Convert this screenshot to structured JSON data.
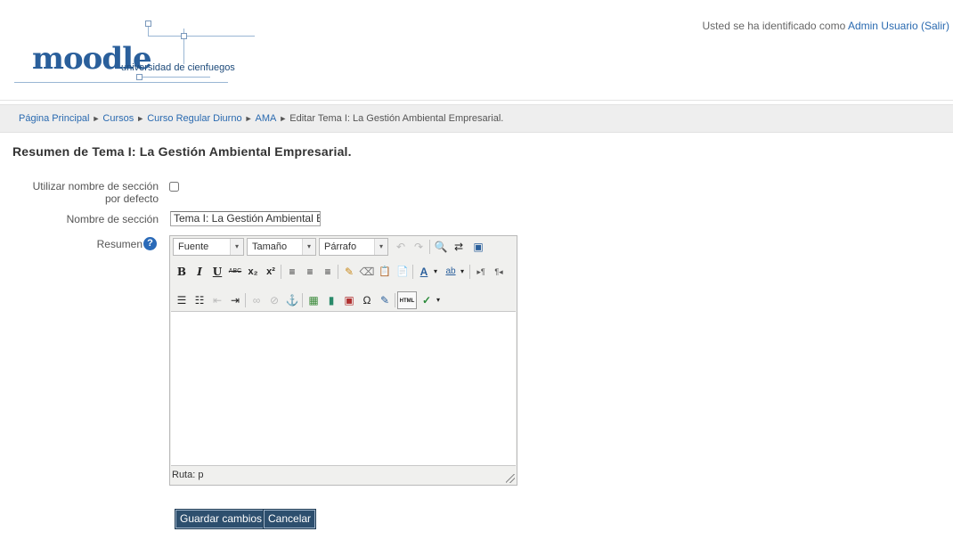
{
  "header": {
    "logo_word": "moodle",
    "logo_subtitle": "universidad de cienfuegos",
    "login_prefix": "Usted se ha identificado como ",
    "login_user": "Admin Usuario",
    "login_logout": "(Salir)"
  },
  "breadcrumb": {
    "items": [
      "Página Principal",
      "Cursos",
      "Curso Regular Diurno",
      "AMA",
      "Editar Tema I: La Gestión Ambiental Empresarial."
    ],
    "separator": "►"
  },
  "page": {
    "title": "Resumen de Tema I: La Gestión Ambiental Empresarial."
  },
  "form": {
    "default_name_label": "Utilizar nombre de sección por defecto",
    "default_name_checked": false,
    "section_name_label": "Nombre de sección",
    "section_name_value": "Tema I: La Gestión Ambiental Er",
    "summary_label": "Resumen",
    "help_glyph": "?",
    "save_label": "Guardar cambios",
    "cancel_label": "Cancelar"
  },
  "editor": {
    "font_select": "Fuente",
    "size_select": "Tamaño",
    "format_select": "Párrafo",
    "status_path": "Ruta: p",
    "icons": {
      "undo": "undo-icon",
      "redo": "redo-icon",
      "find": "find-icon",
      "replace": "replace-icon",
      "fullscreen": "fullscreen-icon",
      "bold": "bold-icon",
      "italic": "italic-icon",
      "underline": "underline-icon",
      "strikethrough": "strikethrough-icon",
      "subscript": "subscript-icon",
      "superscript": "superscript-icon",
      "align_left": "align-left-icon",
      "align_center": "align-center-icon",
      "align_right": "align-right-icon",
      "clean": "cleanup-icon",
      "remove_format": "remove-format-icon",
      "paste_text": "paste-text-icon",
      "paste_word": "paste-word-icon",
      "text_color": "text-color-icon",
      "bg_color": "highlight-color-icon",
      "ltr": "ltr-icon",
      "rtl": "rtl-icon",
      "bullets": "bullet-list-icon",
      "numbers": "numbered-list-icon",
      "outdent": "outdent-icon",
      "indent": "indent-icon",
      "link": "link-icon",
      "unlink": "unlink-icon",
      "anchor": "anchor-icon",
      "image": "image-icon",
      "media": "media-icon",
      "moodle_media": "moodle-media-icon",
      "charmap": "special-char-icon",
      "nonbreaking": "edit-icon",
      "html": "html-source-icon",
      "spellcheck": "spellcheck-icon"
    },
    "glyphs": {
      "undo": "↶",
      "redo": "↷",
      "find": "🔍",
      "replace": "⇄",
      "fullscreen": "▣",
      "bold": "B",
      "italic": "I",
      "underline": "U",
      "strike": "ABC",
      "sub": "x₂",
      "sup": "x²",
      "align_left": "≡",
      "align_center": "≡",
      "align_right": "≡",
      "clean": "✎",
      "remove_format": "⌫",
      "paste_text": "📋",
      "paste_word": "📄",
      "text_color": "A",
      "bg_color": "ab",
      "ltr": "▸¶",
      "rtl": "¶◂",
      "bullets": "☰",
      "numbers": "☷",
      "outdent": "⇤",
      "indent": "⇥",
      "link": "∞",
      "unlink": "⊘",
      "anchor": "⚓",
      "image": "▦",
      "media": "▮",
      "moodle_media": "▣",
      "charmap": "Ω",
      "nonbreaking": "✎",
      "html": "HTML",
      "spellcheck": "✓",
      "dropdown": "▾"
    }
  }
}
